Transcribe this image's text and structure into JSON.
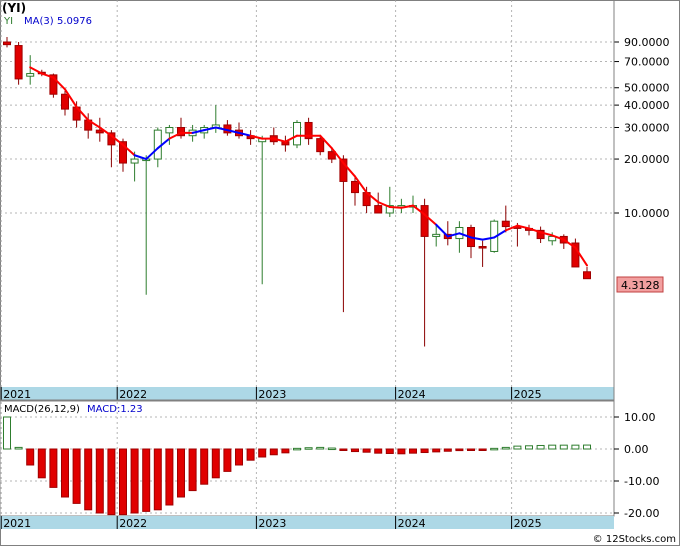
{
  "header": {
    "symbol": "(YI)",
    "legend_symbol": "YI",
    "legend_ma": "MA(3)",
    "legend_ma_value": "5.0976"
  },
  "macd_panel": {
    "label": "MACD(26,12,9)",
    "value_label": "MACD:1.23"
  },
  "last_price_label": "4.3128",
  "watermark": "© 12Stocks.com",
  "colors": {
    "up": "#2e7d2e",
    "down": "#e00000",
    "ma_down": "#ff0000",
    "ma_up": "#0000ff",
    "axis_band": "#add8e6",
    "grid": "#b4b4b4",
    "label_box": "#f2a0a0"
  },
  "chart_data": [
    {
      "type": "candlestick",
      "scale": "log",
      "period": "monthly",
      "y_ticks": [
        "90.0000",
        "70.0000",
        "50.0000",
        "40.0000",
        "30.0000",
        "20.0000",
        "10.0000"
      ],
      "y_tick_values": [
        90,
        70,
        50,
        40,
        30,
        20,
        10
      ],
      "x_labels": [
        "2021",
        "2022",
        "2023",
        "2024",
        "2025"
      ],
      "x_label_index": [
        0,
        10,
        22,
        34,
        44
      ],
      "series": [
        {
          "o": 90,
          "h": 96,
          "l": 84,
          "c": 87
        },
        {
          "o": 86,
          "h": 90,
          "l": 52,
          "c": 56
        },
        {
          "o": 58,
          "h": 76,
          "l": 52,
          "c": 60
        },
        {
          "o": 61,
          "h": 63,
          "l": 58,
          "c": 60
        },
        {
          "o": 59,
          "h": 60,
          "l": 44,
          "c": 46
        },
        {
          "o": 46,
          "h": 48,
          "l": 35,
          "c": 38
        },
        {
          "o": 39,
          "h": 42,
          "l": 30,
          "c": 33
        },
        {
          "o": 33,
          "h": 36,
          "l": 26,
          "c": 29
        },
        {
          "o": 29,
          "h": 34,
          "l": 25,
          "c": 28
        },
        {
          "o": 28,
          "h": 29,
          "l": 18,
          "c": 24
        },
        {
          "o": 25,
          "h": 26,
          "l": 17,
          "c": 19
        },
        {
          "o": 19,
          "h": 22,
          "l": 15,
          "c": 20
        },
        {
          "o": 20,
          "h": 21,
          "l": 3.5,
          "c": 20
        },
        {
          "o": 20,
          "h": 30,
          "l": 18,
          "c": 29
        },
        {
          "o": 28,
          "h": 31,
          "l": 24,
          "c": 30
        },
        {
          "o": 30,
          "h": 34,
          "l": 26,
          "c": 27
        },
        {
          "o": 27,
          "h": 31,
          "l": 25,
          "c": 29
        },
        {
          "o": 28,
          "h": 31,
          "l": 26,
          "c": 30
        },
        {
          "o": 30,
          "h": 40,
          "l": 28,
          "c": 31
        },
        {
          "o": 31,
          "h": 33,
          "l": 27,
          "c": 28
        },
        {
          "o": 29,
          "h": 32,
          "l": 26,
          "c": 27
        },
        {
          "o": 27,
          "h": 29,
          "l": 24,
          "c": 26
        },
        {
          "o": 25,
          "h": 27,
          "l": 4.0,
          "c": 26
        },
        {
          "o": 27,
          "h": 30,
          "l": 24,
          "c": 25
        },
        {
          "o": 25,
          "h": 27,
          "l": 22,
          "c": 24
        },
        {
          "o": 24,
          "h": 33,
          "l": 23,
          "c": 32
        },
        {
          "o": 32,
          "h": 34,
          "l": 24,
          "c": 26
        },
        {
          "o": 26,
          "h": 27,
          "l": 21,
          "c": 22
        },
        {
          "o": 22,
          "h": 23,
          "l": 19,
          "c": 20
        },
        {
          "o": 20,
          "h": 21,
          "l": 2.8,
          "c": 15
        },
        {
          "o": 15,
          "h": 16,
          "l": 11,
          "c": 13
        },
        {
          "o": 13,
          "h": 14,
          "l": 10,
          "c": 11
        },
        {
          "o": 11,
          "h": 13,
          "l": 10,
          "c": 10
        },
        {
          "o": 10,
          "h": 14,
          "l": 9.5,
          "c": 11
        },
        {
          "o": 11,
          "h": 12,
          "l": 10,
          "c": 11
        },
        {
          "o": 11,
          "h": 12.5,
          "l": 10,
          "c": 11
        },
        {
          "o": 11,
          "h": 12,
          "l": 1.8,
          "c": 7.4
        },
        {
          "o": 7.4,
          "h": 8.5,
          "l": 6.5,
          "c": 7.6
        },
        {
          "o": 7.6,
          "h": 9,
          "l": 6.6,
          "c": 7.2
        },
        {
          "o": 7.2,
          "h": 9,
          "l": 6.0,
          "c": 8.3
        },
        {
          "o": 8.3,
          "h": 8.6,
          "l": 5.6,
          "c": 6.5
        },
        {
          "o": 6.5,
          "h": 7,
          "l": 5.0,
          "c": 6.4
        },
        {
          "o": 6.1,
          "h": 9.2,
          "l": 6.0,
          "c": 9.0
        },
        {
          "o": 9.0,
          "h": 11,
          "l": 7.8,
          "c": 8.4
        },
        {
          "o": 8.4,
          "h": 8.8,
          "l": 6.5,
          "c": 8.2
        },
        {
          "o": 8.2,
          "h": 8.6,
          "l": 7.5,
          "c": 8.0
        },
        {
          "o": 8.0,
          "h": 8.4,
          "l": 6.8,
          "c": 7.2
        },
        {
          "o": 7.0,
          "h": 7.8,
          "l": 6.6,
          "c": 7.4
        },
        {
          "o": 7.4,
          "h": 7.6,
          "l": 6.3,
          "c": 6.8
        },
        {
          "o": 6.8,
          "h": 7.2,
          "l": 5.4,
          "c": 5.0
        },
        {
          "o": 4.7,
          "h": 5.0,
          "l": 4.3,
          "c": 4.3
        }
      ],
      "ma": {
        "name": "MA(3)",
        "values": [
          null,
          null,
          65,
          60,
          57,
          49,
          39,
          33,
          30,
          27,
          24,
          21,
          20,
          23,
          26,
          28,
          28,
          29,
          30,
          29,
          28,
          27,
          26,
          26,
          25,
          27,
          27,
          27,
          23,
          19,
          16,
          13,
          11.5,
          10.8,
          10.7,
          11,
          9.8,
          8.6,
          7.4,
          7.7,
          7.3,
          7.1,
          7.3,
          8.0,
          8.5,
          8.2,
          7.8,
          7.5,
          7.1,
          6.4,
          5.1
        ],
        "rising_segments": [
          [
            11,
            14
          ],
          [
            16,
            21
          ],
          [
            37,
            43
          ]
        ]
      },
      "last": 4.3128
    },
    {
      "type": "bar",
      "name": "MACD",
      "y_ticks": [
        "10.00",
        "0.00",
        "-10.00",
        "-20.00"
      ],
      "y_tick_values": [
        10,
        0,
        -10,
        -20
      ],
      "x_labels": [
        "2021",
        "2022",
        "2023",
        "2024",
        "2025"
      ],
      "values": [
        10,
        0.5,
        -5,
        -9,
        -12,
        -15,
        -17,
        -19,
        -20,
        -20.5,
        -20.5,
        -20,
        -19.5,
        -19,
        -17.5,
        -15,
        -13,
        -11,
        -9,
        -7,
        -5,
        -3.5,
        -2.5,
        -1.8,
        -1.2,
        0.2,
        0.4,
        0.5,
        0.3,
        -0.2,
        -0.8,
        -1.0,
        -1.3,
        -1.4,
        -1.5,
        -1.3,
        -1.1,
        -0.9,
        -0.7,
        -0.5,
        -0.3,
        -0.1,
        0.2,
        0.5,
        0.9,
        1.0,
        1.1,
        1.2,
        1.2,
        1.2,
        1.23
      ],
      "ylim": [
        -21,
        12
      ]
    }
  ]
}
